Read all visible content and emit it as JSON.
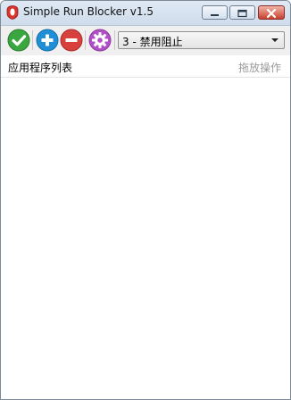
{
  "window": {
    "title": "Simple Run Blocker v1.5",
    "icon": "app-shield-icon",
    "controls": [
      "minimize-icon",
      "maximize-icon",
      "close-icon"
    ]
  },
  "toolbar": {
    "buttons": [
      {
        "name": "apply",
        "icon": "checkmark-icon",
        "color": "#3aa640"
      },
      {
        "name": "add",
        "icon": "plus-icon",
        "color": "#1e8fd6"
      },
      {
        "name": "remove",
        "icon": "minus-icon",
        "color": "#d8403d"
      },
      {
        "name": "settings",
        "icon": "gear-icon",
        "color": "#b24fc8"
      }
    ],
    "mode_select": {
      "value": "3 - 禁用阻止"
    }
  },
  "list": {
    "column_apps": "应用程序列表",
    "column_drag": "拖放操作",
    "items": []
  }
}
